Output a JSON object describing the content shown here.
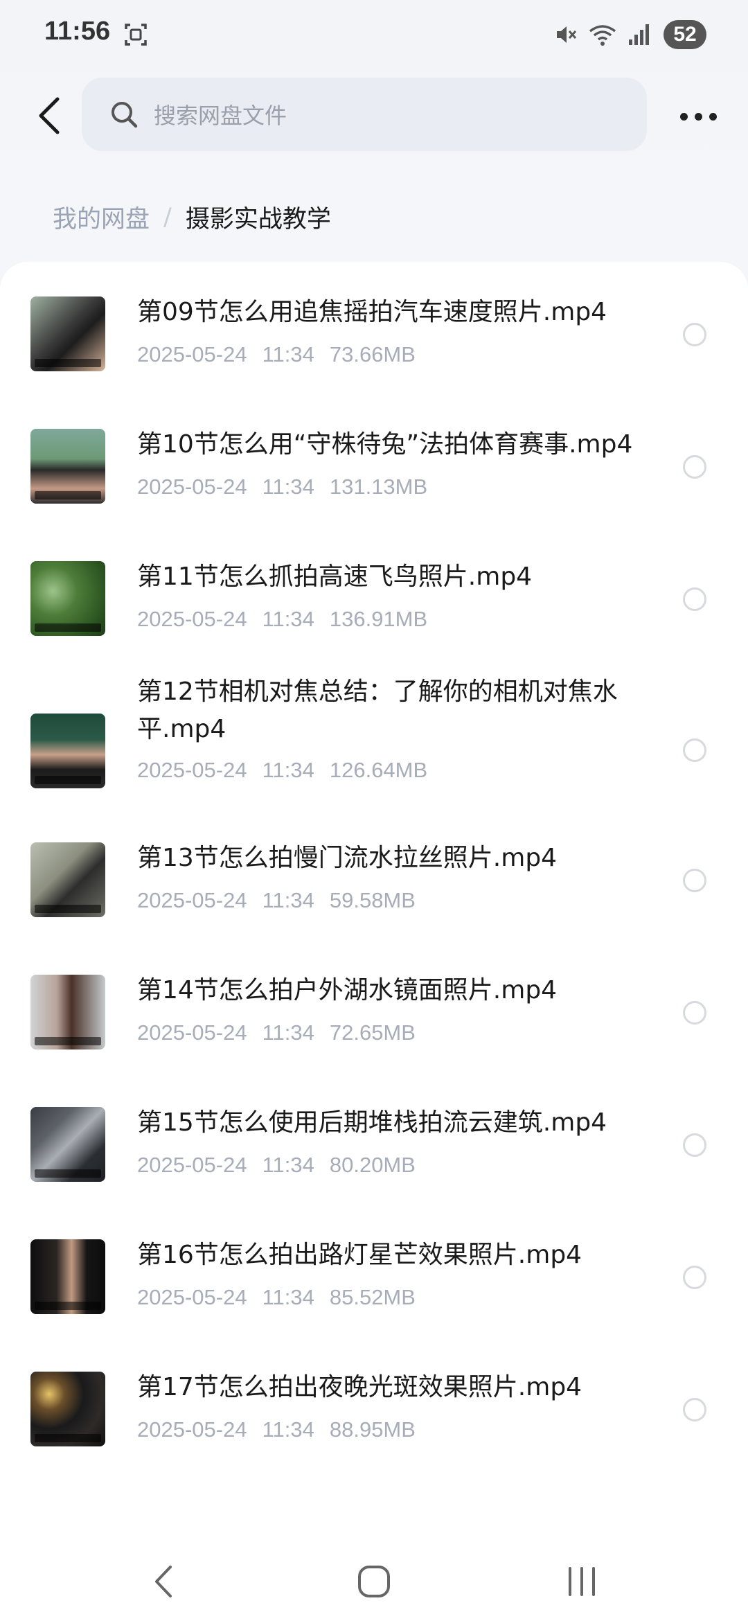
{
  "status_bar": {
    "time": "11:56",
    "battery": "52",
    "icons": [
      "screenshot-icon",
      "mute-icon",
      "wifi-icon",
      "signal-icon"
    ]
  },
  "header": {
    "search_placeholder": "搜索网盘文件",
    "back_icon": "chevron-left-icon",
    "more_icon": "more-horizontal-icon"
  },
  "breadcrumb": {
    "root": "我的网盘",
    "separator": "/",
    "current": "摄影实战教学"
  },
  "files": [
    {
      "name": "第09节怎么用追焦摇拍汽车速度照片.mp4",
      "date": "2025-05-24",
      "time": "11:34",
      "size": "73.66MB"
    },
    {
      "name": "第10节怎么用“守株待兔”法拍体育赛事.mp4",
      "date": "2025-05-24",
      "time": "11:34",
      "size": "131.13MB"
    },
    {
      "name": "第11节怎么抓拍高速飞鸟照片.mp4",
      "date": "2025-05-24",
      "time": "11:34",
      "size": "136.91MB"
    },
    {
      "name": "第12节相机对焦总结：了解你的相机对焦水平.mp4",
      "date": "2025-05-24",
      "time": "11:34",
      "size": "126.64MB"
    },
    {
      "name": "第13节怎么拍慢门流水拉丝照片.mp4",
      "date": "2025-05-24",
      "time": "11:34",
      "size": "59.58MB"
    },
    {
      "name": "第14节怎么拍户外湖水镜面照片.mp4",
      "date": "2025-05-24",
      "time": "11:34",
      "size": "72.65MB"
    },
    {
      "name": "第15节怎么使用后期堆栈拍流云建筑.mp4",
      "date": "2025-05-24",
      "time": "11:34",
      "size": "80.20MB"
    },
    {
      "name": "第16节怎么拍出路灯星芒效果照片.mp4",
      "date": "2025-05-24",
      "time": "11:34",
      "size": "85.52MB"
    },
    {
      "name": "第17节怎么拍出夜晚光斑效果照片.mp4",
      "date": "2025-05-24",
      "time": "11:34",
      "size": "88.95MB"
    }
  ],
  "nav_bar": {
    "icons": [
      "back-nav-icon",
      "home-nav-icon",
      "recents-nav-icon"
    ]
  }
}
